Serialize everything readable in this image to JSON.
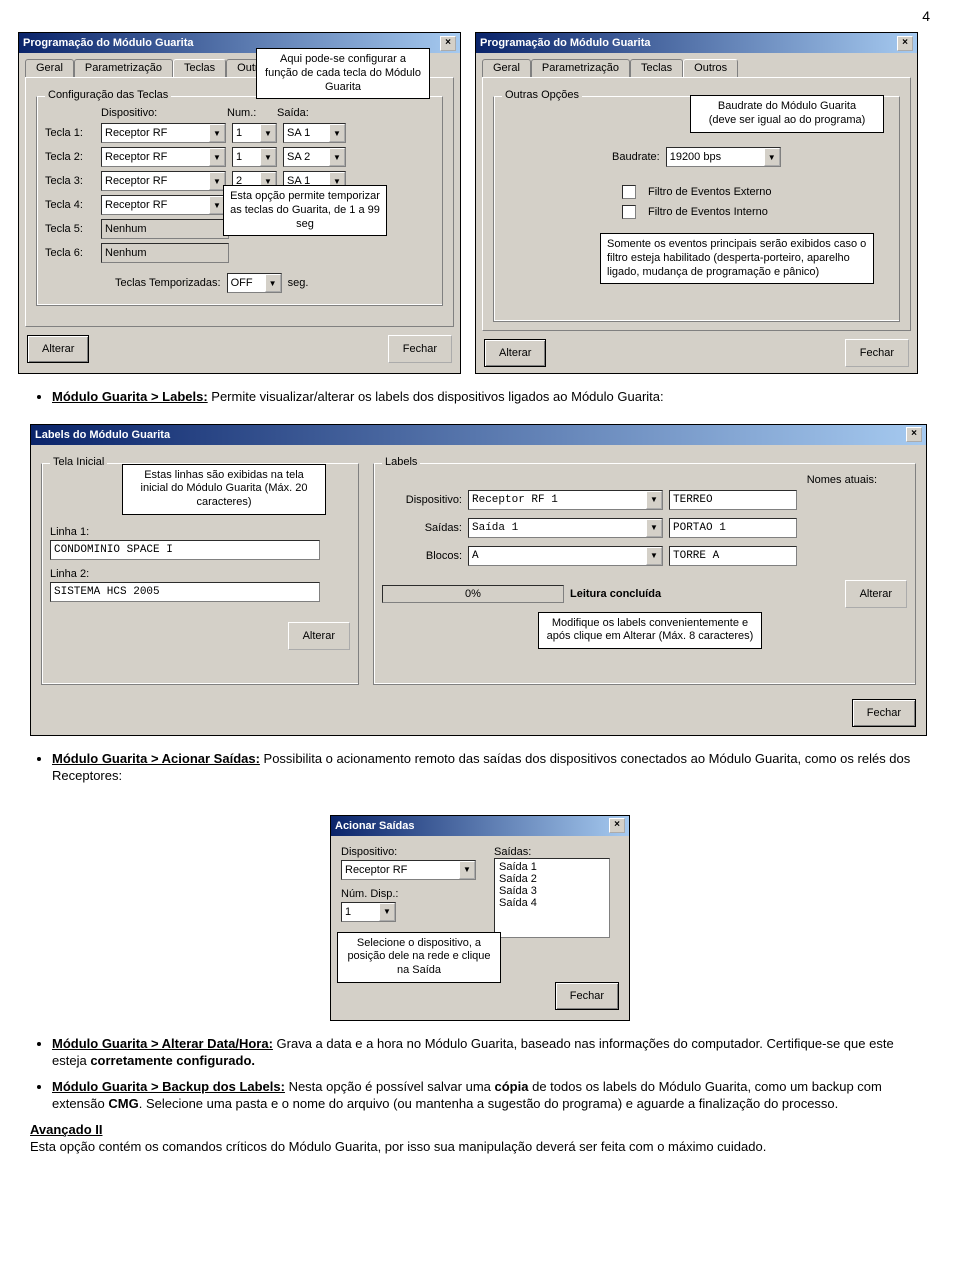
{
  "page_number": "4",
  "window_title": "Programação do Módulo Guarita",
  "tabs": {
    "geral": "Geral",
    "param": "Parametrização",
    "teclas": "Teclas",
    "outros": "Outros"
  },
  "teclas": {
    "group": "Configuração das Teclas",
    "col_disp": "Dispositivo:",
    "col_num": "Num.:",
    "col_saida": "Saída:",
    "rows": [
      {
        "lbl": "Tecla 1:",
        "disp": "Receptor RF",
        "num": "1",
        "saida": "SA 1"
      },
      {
        "lbl": "Tecla 2:",
        "disp": "Receptor RF",
        "num": "1",
        "saida": "SA 2"
      },
      {
        "lbl": "Tecla 3:",
        "disp": "Receptor RF",
        "num": "2",
        "saida": "SA 1"
      },
      {
        "lbl": "Tecla 4:",
        "disp": "Receptor RF",
        "num": "",
        "saida": ""
      },
      {
        "lbl": "Tecla 5:",
        "disp": "Nenhum",
        "num": "",
        "saida": ""
      },
      {
        "lbl": "Tecla 6:",
        "disp": "Nenhum",
        "num": "",
        "saida": ""
      }
    ],
    "timed_label": "Teclas Temporizadas:",
    "timed_value": "OFF",
    "timed_unit": "seg.",
    "tooltip_title": "Aqui pode-se configurar a função de cada tecla do Módulo Guarita",
    "tooltip_temp": "Esta opção permite temporizar as teclas do Guarita, de 1 a 99 seg"
  },
  "outros": {
    "group": "Outras Opções",
    "note_baud": "Baudrate do Módulo Guarita\n(deve ser igual ao do programa)",
    "baud_label": "Baudrate:",
    "baud_value": "19200 bps",
    "chk_ext": "Filtro de Eventos Externo",
    "chk_int": "Filtro de Eventos Interno",
    "note_filter": "Somente os eventos principais serão exibidos caso o filtro esteja habilitado (desperta-porteiro, aparelho ligado, mudança de programação e pânico)"
  },
  "btn_alterar": "Alterar",
  "btn_fechar": "Fechar",
  "doc": {
    "labels_title": "Módulo Guarita > Labels:",
    "labels_text": " Permite visualizar/alterar os labels dos dispositivos ligados ao Módulo Guarita:",
    "saidas_title": "Módulo Guarita > Acionar Saídas:",
    "saidas_text": " Possibilita o acionamento remoto das saídas dos dispositivos conectados ao Módulo Guarita, como os relés dos Receptores:",
    "datahora_title": "Módulo Guarita > Alterar Data/Hora:",
    "datahora_text": " Grava a data e a hora no Módulo Guarita, baseado nas informações do computador. Certifique-se que este esteja ",
    "datahora_text2": "corretamente configurado.",
    "backup_title": "Módulo Guarita > Backup dos Labels:",
    "backup_text": " Nesta opção é possível salvar uma ",
    "backup_text_b": "cópia",
    "backup_text2": " de todos os labels do Módulo Guarita, como um backup com extensão ",
    "backup_text_b2": "CMG",
    "backup_text3": ". Selecione uma pasta e o nome do arquivo (ou mantenha a sugestão do programa) e aguarde a finalização do processo.",
    "avancado_title": "Avançado II",
    "avancado_text": "Esta opção contém os comandos críticos do Módulo Guarita, por isso sua manipulação deverá ser feita com o máximo cuidado."
  },
  "labels_dialog": {
    "title": "Labels do Módulo Guarita",
    "tela_group": "Tela Inicial",
    "tooltip_tela": "Estas linhas são exibidas na tela inicial do Módulo Guarita (Máx. 20 caracteres)",
    "linha1_lbl": "Linha 1:",
    "linha1_val": "CONDOMINIO SPACE I",
    "linha2_lbl": "Linha 2:",
    "linha2_val": "SISTEMA HCS 2005",
    "labels_group": "Labels",
    "nomes_lbl": "Nomes atuais:",
    "disp_lbl": "Dispositivo:",
    "disp_val": "Receptor RF 1",
    "disp_nome": "TERREO",
    "saidas_lbl": "Saídas:",
    "saidas_val": "Saída 1",
    "saidas_nome": "PORTAO 1",
    "blocos_lbl": "Blocos:",
    "blocos_val": "A",
    "blocos_nome": "TORRE A",
    "progress_text": "0%",
    "status": "Leitura concluída",
    "tooltip_alterar": "Modifique os labels convenientemente e após clique em Alterar (Máx. 8 caracteres)"
  },
  "acionar_dialog": {
    "title": "Acionar Saídas",
    "disp_lbl": "Dispositivo:",
    "disp_val": "Receptor RF",
    "num_lbl": "Núm. Disp.:",
    "num_val": "1",
    "saidas_lbl": "Saídas:",
    "saidas_items": [
      "Saída 1",
      "Saída 2",
      "Saída 3",
      "Saída 4"
    ],
    "tooltip": "Selecione o dispositivo, a posição dele na rede e clique na Saída"
  }
}
